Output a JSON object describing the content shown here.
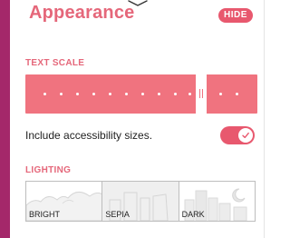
{
  "panel": {
    "title": "Appearance",
    "hide_label": "HIDE"
  },
  "text_scale": {
    "section_label": "TEXT SCALE",
    "steps": 12,
    "selected_step": 10
  },
  "accessibility": {
    "label": "Include accessibility sizes.",
    "enabled": true
  },
  "lighting": {
    "section_label": "LIGHTING",
    "options": [
      {
        "label": "BRIGHT",
        "icon": "hills-sun-icon"
      },
      {
        "label": "SEPIA",
        "icon": "buildings-icon"
      },
      {
        "label": "DARK",
        "icon": "city-moon-icon"
      }
    ]
  },
  "colors": {
    "accent": "#e5677a",
    "track": "#f0737f",
    "sidebar": "#a4286a"
  }
}
